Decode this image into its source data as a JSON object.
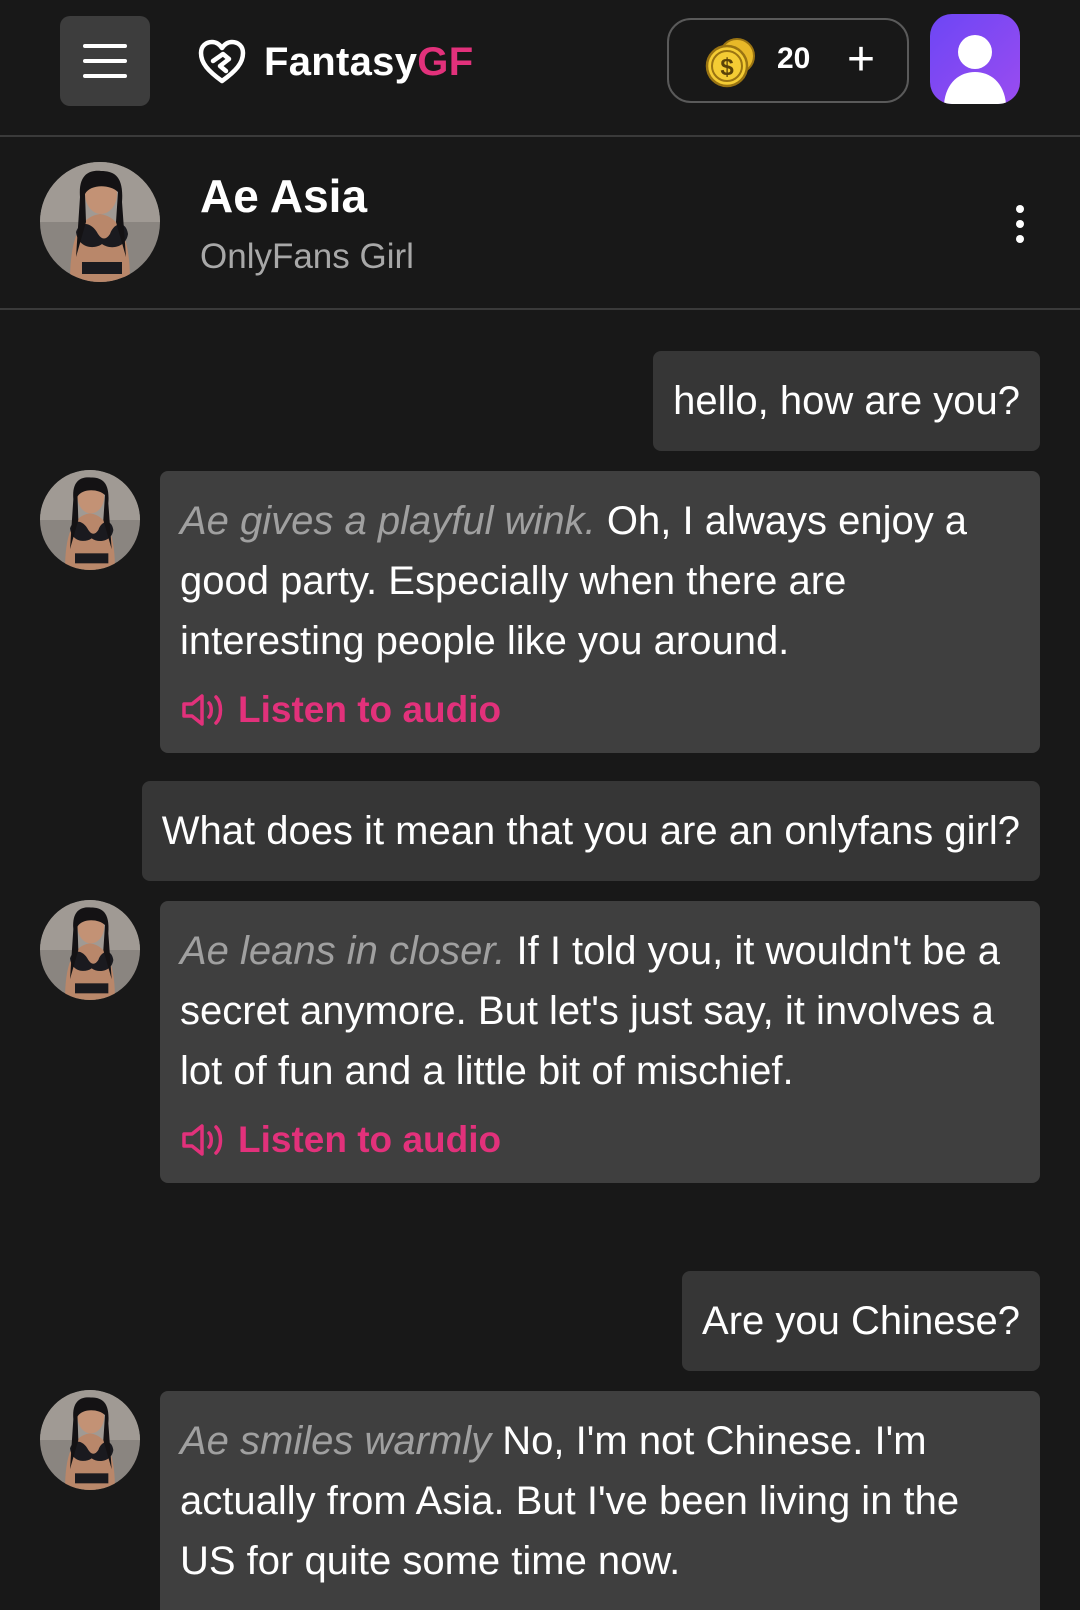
{
  "header": {
    "logo_main": "Fantasy",
    "logo_accent": "GF",
    "coin_count": "20",
    "coin_plus": "+"
  },
  "chat": {
    "name": "Ae Asia",
    "subtitle": "OnlyFans Girl"
  },
  "messages": [
    {
      "role": "user",
      "text": "hello, how are you?"
    },
    {
      "role": "bot",
      "action": "Ae gives a playful wink.",
      "text": " Oh, I always enjoy a good party. Especially when there are interesting people like you around.",
      "audio_label": "Listen to audio"
    },
    {
      "role": "user",
      "text": "What does it mean that you are an onlyfans girl?"
    },
    {
      "role": "bot",
      "action": "Ae leans in closer.",
      "text": " If I told you, it wouldn't be a secret anymore. But let's just say, it involves a lot of fun and a little bit of mischief.",
      "audio_label": "Listen to audio"
    },
    {
      "role": "user",
      "text": "Are you Chinese?"
    },
    {
      "role": "bot",
      "action": "Ae smiles warmly",
      "text": " No, I'm not Chinese. I'm actually from Asia. But I've been living in the US for quite some time now."
    }
  ],
  "colors": {
    "accent": "#e2317b",
    "background": "#181818",
    "bubble": "#3f3f3f",
    "profile_gradient_start": "#6d46f5",
    "profile_gradient_end": "#9a4cf0"
  },
  "icons": {
    "menu": "hamburger-icon",
    "logo": "heart-logo-icon",
    "coin": "coin-icon",
    "profile": "user-icon",
    "more": "kebab-menu-icon",
    "audio": "speaker-icon"
  }
}
